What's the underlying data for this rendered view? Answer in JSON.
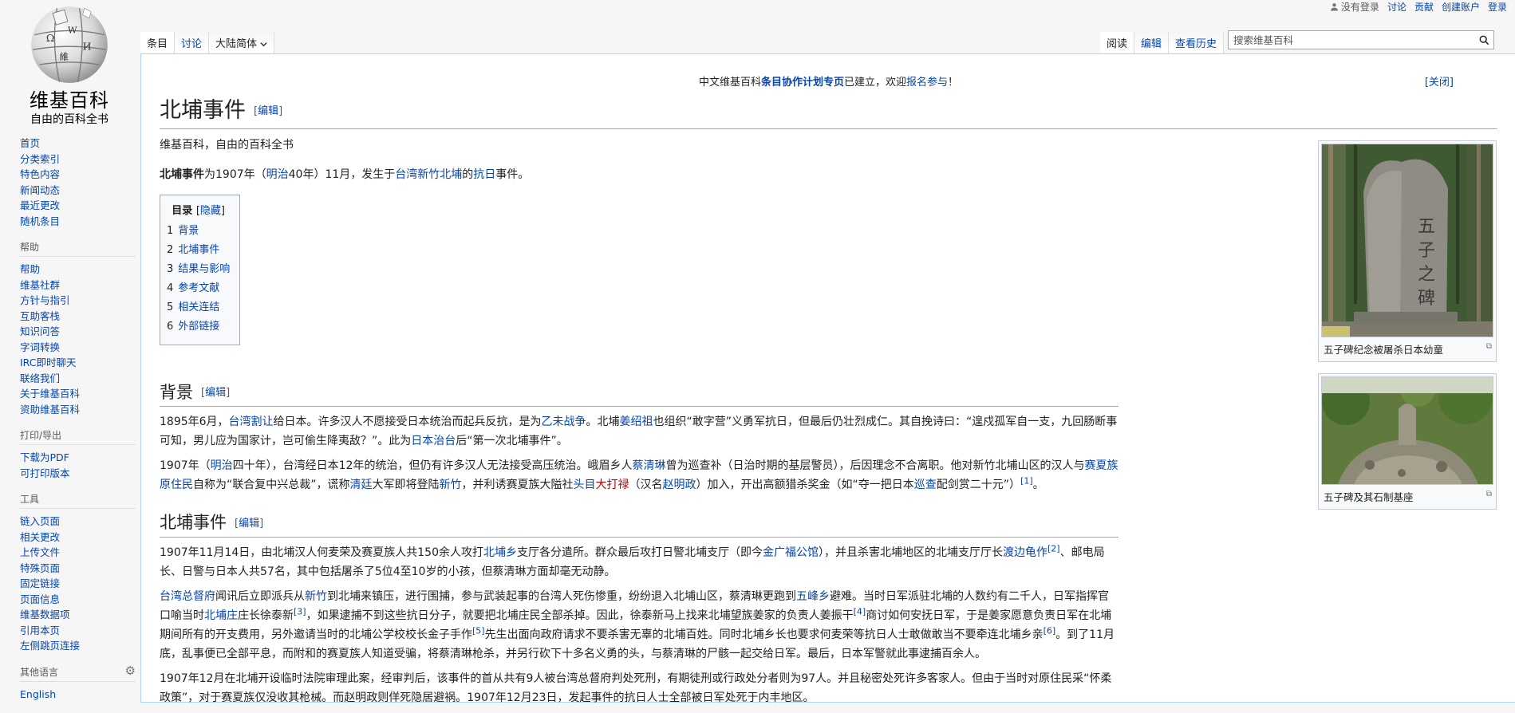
{
  "personal": {
    "not_logged": "没有登录",
    "talk": "讨论",
    "contribs": "贡献",
    "create": "创建账户",
    "login": "登录"
  },
  "logo": {
    "title": "维基百科",
    "tagline": "自由的百科全书"
  },
  "sidebar": {
    "nav": [
      "首页",
      "分类索引",
      "特色内容",
      "新闻动态",
      "最近更改",
      "随机条目"
    ],
    "help_title": "帮助",
    "help": [
      "帮助",
      "维基社群",
      "方针与指引",
      "互助客栈",
      "知识问答",
      "字词转换",
      "IRC即时聊天",
      "联络我们",
      "关于维基百科",
      "资助维基百科"
    ],
    "print_title": "打印/导出",
    "print": [
      "下载为PDF",
      "可打印版本"
    ],
    "tools_title": "工具",
    "tools": [
      "链入页面",
      "相关更改",
      "上传文件",
      "特殊页面",
      "固定链接",
      "页面信息",
      "维基数据项",
      "引用本页",
      "左侧跳页连接"
    ],
    "lang_title": "其他语言",
    "langs": [
      "English"
    ]
  },
  "tabs": {
    "article": "条目",
    "talk": "讨论",
    "variant": "大陆简体",
    "read": "阅读",
    "edit": "编辑",
    "history": "查看历史"
  },
  "search": {
    "placeholder": "搜索维基百科"
  },
  "notice": {
    "t1": "中文维基百科",
    "t2": "条目协作计划专页",
    "t3": "已建立，欢迎",
    "t4": "报名参与",
    "t5": "！",
    "close": "[关闭]"
  },
  "title": "北埔事件",
  "edit_label": "编辑",
  "sitesub": "维基百科，自由的百科全书",
  "intro": {
    "p0": "北埔事件",
    "p1": "为1907年（",
    "p2": "明治",
    "p3": "40年）11月，发生于",
    "p4": "台湾新竹北埔",
    "p5": "的",
    "p6": "抗日",
    "p7": "事件。"
  },
  "toc": {
    "title": "目录",
    "hide": "隐藏",
    "items": [
      {
        "num": "1",
        "label": "背景"
      },
      {
        "num": "2",
        "label": "北埔事件"
      },
      {
        "num": "3",
        "label": "结果与影响"
      },
      {
        "num": "4",
        "label": "参考文献"
      },
      {
        "num": "5",
        "label": "相关连结"
      },
      {
        "num": "6",
        "label": "外部链接"
      }
    ]
  },
  "sec1": {
    "heading": "背景",
    "p1": {
      "a": "1895年6月，",
      "b": "台湾割让",
      "c": "给日本。许多汉人不愿接受日本统治而起兵反抗，是为",
      "d": "乙未战争",
      "e": "。北埔",
      "f": "姜绍祖",
      "g": "也组织“敢字营”义勇军抗日，但最后仍壮烈成仁。其自挽诗曰：“遑戍孤军自一支，九回肠断事可知，男儿应为国家计，岂可偷生降夷敌？”。此为",
      "h": "日本治台",
      "i": "后“第一次北埔事件”。"
    },
    "p2": {
      "a": "1907年（",
      "b": "明治",
      "c": "四十年），台湾经日本12年的统治，但仍有许多汉人无法接受高压统治。峨眉乡人",
      "d": "蔡清琳",
      "e": "曾为巡查补（日治时期的基层警员），后因理念不合离职。他对新竹北埔山区的汉人与",
      "f": "赛夏族原住民",
      "g": "自称为“联合复中兴总裁”，谎称",
      "h": "清廷",
      "i": "大军即将登陆",
      "j": "新竹",
      "k": "，并利诱赛夏族大隘社",
      "l": "头目",
      "m": "大打禄",
      "n": "（汉名",
      "o": "赵明政",
      "p": "）加入，开出高额猎杀奖金（如“夺一把日本",
      "q": "巡查",
      "r": "配剑赏二十元”）",
      "s": "[1]",
      "t": "。"
    }
  },
  "sec2": {
    "heading": "北埔事件",
    "p1": {
      "a": "1907年11月14日，由北埔汉人何麦荣及赛夏族人共150余人攻打",
      "b": "北埔乡",
      "c": "支厅各分遣所。群众最后攻打日警北埔支厅（即今",
      "d": "金广福公馆",
      "e": "），并且杀害北埔地区的北埔支厅厅长",
      "f": "渡边龟作",
      "g": "[2]",
      "h": "、邮电局长、日警与日本人共57名，其中包括屠杀了5位4至10岁的小孩，但蔡清琳方面却毫无动静。"
    },
    "p2": {
      "a": "台湾总督府",
      "b": "闻讯后立即派兵从",
      "c": "新竹",
      "d": "到北埔来镇压，进行围捕，参与武装起事的台湾人死伤惨重，纷纷退入北埔山区，蔡清琳更跑到",
      "e": "五峰乡",
      "f": "避难。当时日军派驻北埔的人数约有二千人，日军指挥官口喻当时",
      "g": "北埔庄",
      "h": "庄长徐泰新",
      "i": "[3]",
      "j": "，如果逮捕不到这些抗日分子，就要把北埔庄民全部杀掉。因此，徐泰新马上找来北埔望族姜家的负责人姜振干",
      "k": "[4]",
      "l": "商讨如何安抚日军，于是姜家愿意负责日军在北埔期间所有的开支费用，另外邀请当时的北埔公学校校长金子手作",
      "m": "[5]",
      "n": "先生出面向政府请求不要杀害无辜的北埔百姓。同时北埔乡长也要求何麦荣等抗日人士敢做敢当不要牵连北埔乡亲",
      "o": "[6]",
      "p": "。到了11月底，乱事便已全部平息，而附和的赛夏族人知道受骗，将蔡清琳枪杀，并另行砍下十多名义勇的头，与蔡清琳的尸骸一起交给日军。最后，日本军警就此事逮捕百余人。"
    },
    "p3": "1907年12月在北埔开设临时法院审理此案，经审判后，该事件的首从共有9人被台湾总督府判处死刑，有期徒刑或行政处分者则为97人。并且秘密处死许多客家人。但由于当时对原住民采“怀柔政策”，对于赛夏族仅没收其枪械。而赵明政则佯死隐居避祸。1907年12月23日，发起事件的抗日人士全部被日军处死于内丰地区。"
  },
  "thumbs": [
    {
      "caption": "五子碑纪念被屠杀日本幼童"
    },
    {
      "caption": "五子碑及其石制基座"
    }
  ],
  "colors": {
    "link": "#0645ad",
    "redlink": "#ba0000",
    "border": "#a7d7f9"
  }
}
